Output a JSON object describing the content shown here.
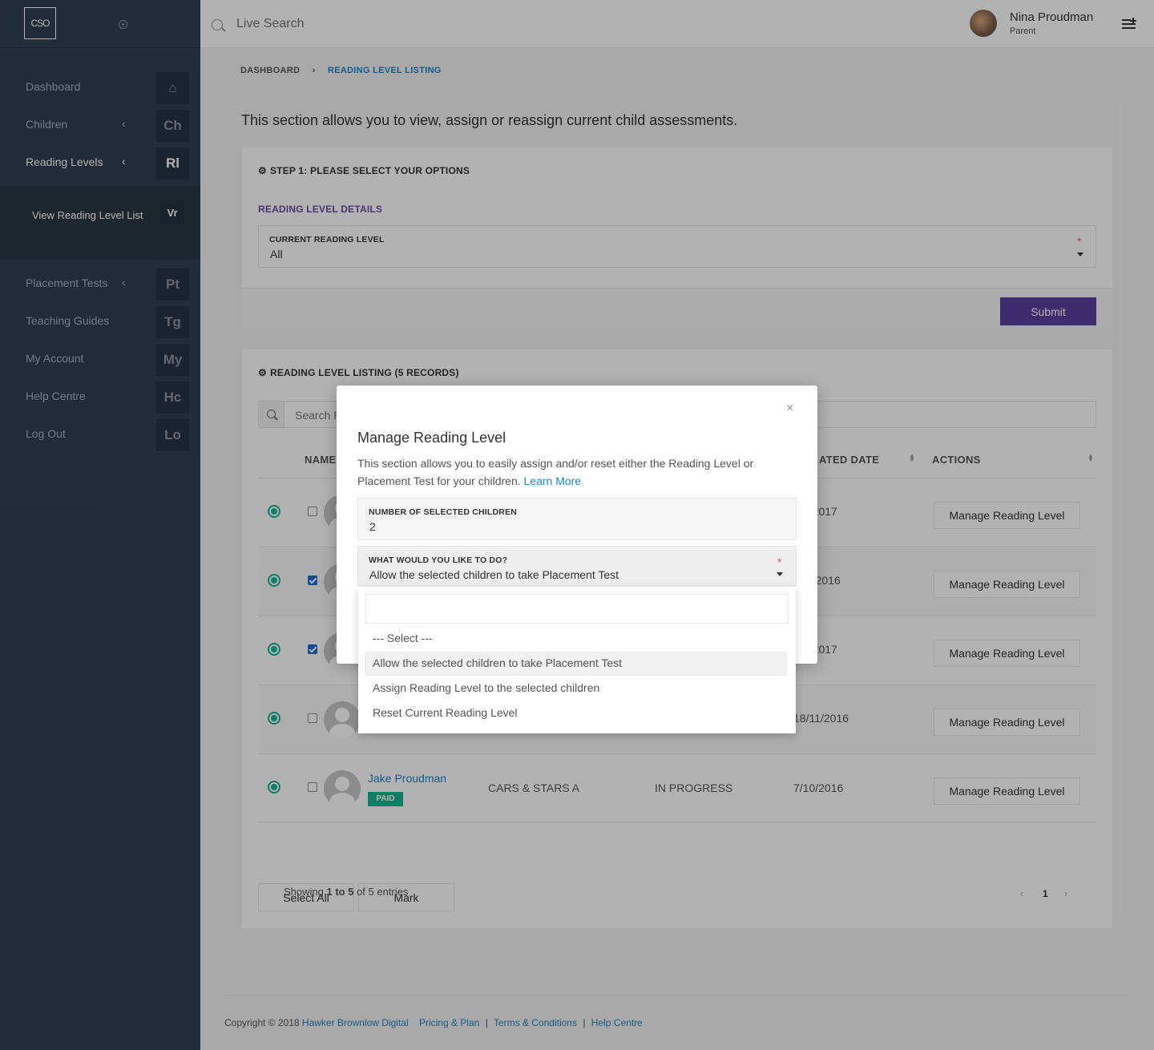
{
  "sidebar": {
    "logo": "CSO",
    "items": [
      {
        "label": "Dashboard",
        "badge": "⌂",
        "chevron": ""
      },
      {
        "label": "Children",
        "badge": "Ch",
        "chevron": "‹"
      },
      {
        "label": "Reading Levels",
        "badge": "Rl",
        "chevron": "‹"
      },
      {
        "label": "Placement Tests",
        "badge": "Pt",
        "chevron": "‹"
      },
      {
        "label": "Teaching Guides",
        "badge": "Tg",
        "chevron": ""
      },
      {
        "label": "My Account",
        "badge": "My",
        "chevron": ""
      },
      {
        "label": "Help Centre",
        "badge": "Hc",
        "chevron": ""
      },
      {
        "label": "Log Out",
        "badge": "Lo",
        "chevron": ""
      }
    ],
    "subitem": {
      "label": "View Reading Level List",
      "badge": "Vr"
    }
  },
  "header": {
    "search_placeholder": "Live Search",
    "user_name": "Nina Proudman",
    "user_role": "Parent"
  },
  "breadcrumb": {
    "home": "DASHBOARD",
    "sep": "›",
    "current": "READING LEVEL LISTING"
  },
  "intro": "This section allows you to view, assign or reassign current child assessments.",
  "step1": {
    "title": "STEP 1: PLEASE SELECT YOUR OPTIONS",
    "section": "READING LEVEL DETAILS",
    "field_label": "CURRENT READING LEVEL",
    "field_value": "All",
    "required": "*",
    "submit": "Submit"
  },
  "listing": {
    "title": "READING LEVEL LISTING (5 RECORDS)",
    "search_placeholder": "Search R",
    "columns": {
      "name": "NAME",
      "date": "ATED DATE",
      "actions": "ACTIONS"
    },
    "rows": [
      {
        "date": "0/2017",
        "checked": false,
        "action": "Manage Reading Level"
      },
      {
        "date": "/1/2016",
        "checked": true,
        "action": "Manage Reading Level"
      },
      {
        "date": "0/2017",
        "checked": true,
        "action": "Manage Reading Level"
      },
      {
        "date": "18/11/2016",
        "checked": false,
        "action": "Manage Reading Level"
      },
      {
        "name": "Jake Proudman",
        "badge": "PAID",
        "level": "CARS & STARS A",
        "status": "IN PROGRESS",
        "date": "7/10/2016",
        "checked": false,
        "action": "Manage Reading Level"
      }
    ],
    "select_all": "Select All",
    "mark": "Mark",
    "showing_prefix": "Showing ",
    "showing_range": "1 to 5",
    "showing_suffix": " of 5 entries",
    "pager": {
      "prev": "‹",
      "page": "1",
      "next": "›"
    }
  },
  "footer": {
    "copyright": "Copyright © 2018",
    "company": "Hawker Brownlow Digital",
    "pricing": "Pricing & Plan",
    "terms": "Terms & Conditions",
    "help": "Help Centre",
    "sep": "|"
  },
  "modal": {
    "close": "×",
    "title": "Manage Reading Level",
    "desc": "This section allows you to easily assign and/or reset either the Reading Level or Placement Test for your children.",
    "learn_more": "Learn More",
    "count_label": "NUMBER OF SELECTED CHILDREN",
    "count_value": "2",
    "action_label": "WHAT WOULD YOU LIKE TO DO?",
    "action_value": "Allow the selected children to take Placement Test",
    "required": "*"
  },
  "dropdown": {
    "options": [
      "--- Select ---",
      "Allow the selected children to take Placement Test",
      "Assign Reading Level to the selected children",
      "Reset Current Reading Level"
    ],
    "selected_index": 1
  },
  "colors": {
    "sidebar": "#2f4050",
    "accent": "#5b3f9f",
    "link": "#1c84c6",
    "success": "#1ab394"
  }
}
